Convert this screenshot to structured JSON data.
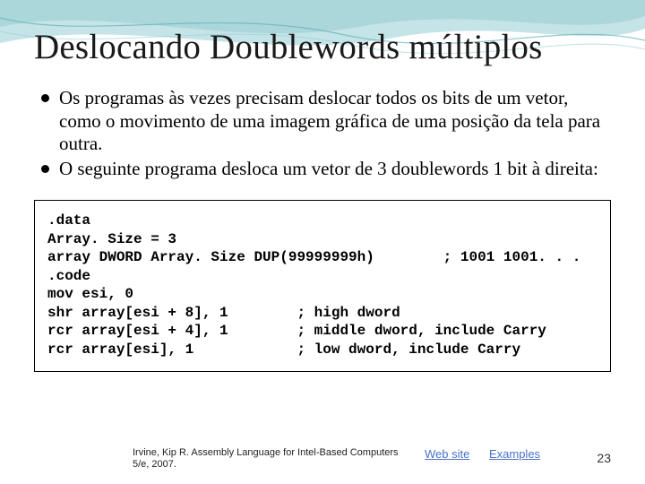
{
  "title": "Deslocando Doublewords múltiplos",
  "bullets": [
    "Os programas às vezes precisam deslocar todos os bits de um vetor, como o movimento de uma imagem gráfica de uma posição da tela para outra.",
    "O seguinte programa desloca um vetor de  3 doublewords 1 bit à direita:"
  ],
  "code": ".data\nArray. Size = 3\narray DWORD Array. Size DUP(99999999h)        ; 1001 1001. . .\n.code\nmov esi, 0\nshr array[esi + 8], 1        ; high dword\nrcr array[esi + 4], 1        ; middle dword, include Carry\nrcr array[esi], 1            ; low dword, include Carry",
  "footer": {
    "citation": "Irvine, Kip R. Assembly Language for Intel-Based Computers 5/e, 2007.",
    "link_web": "Web site",
    "link_examples": "Examples",
    "page": "23"
  }
}
